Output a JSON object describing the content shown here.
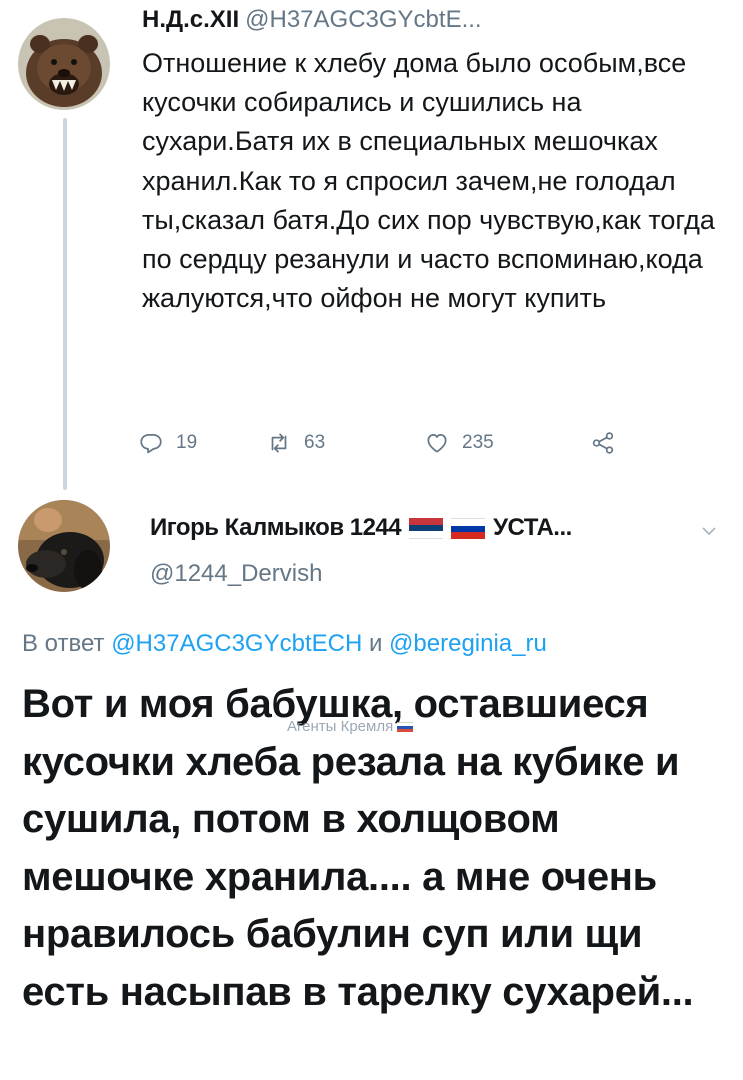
{
  "tweet1": {
    "name": "Н.Д.с.XII",
    "handle": "@H37AGC3GYcbtE...",
    "text": "Отношение к хлебу дома было особым,все кусочки собирались и сушились на сухари.Батя их в специальных мешочках хранил.Как то я спросил зачем,не голодал ты,сказал батя.До сих пор чувствую,как тогда по сердцу резанули и часто вспоминаю,кода жалуются,что ойфон не могут купить",
    "reply_count": "19",
    "retweet_count": "63",
    "like_count": "235",
    "icons": [
      "reply-icon",
      "retweet-icon",
      "like-icon",
      "share-icon"
    ]
  },
  "tweet2": {
    "name": "Игорь Калмыков 1244",
    "name_suffix": "УСТА...",
    "flags": [
      "serbia-flag",
      "russia-flag"
    ],
    "handle": "@1244_Dervish",
    "replying_prefix": "В ответ",
    "replying_user1": "@H37AGC3GYcbtECH",
    "replying_and": "и",
    "replying_user2": "@bereginia_ru",
    "text": "Вот и моя бабушка, оставшиеся кусочки хлеба резала на кубике и сушила, потом в холщовом мешочке хранила.... а мне очень нравилось бабулин суп или щи есть насыпав в тарелку сухарей..."
  },
  "watermark": {
    "text": "Агенты Кремля"
  },
  "colors": {
    "accent": "#1da1f2",
    "secondary_text": "#657786",
    "primary_text": "#14171a",
    "thread_line": "#ccd6dd"
  }
}
